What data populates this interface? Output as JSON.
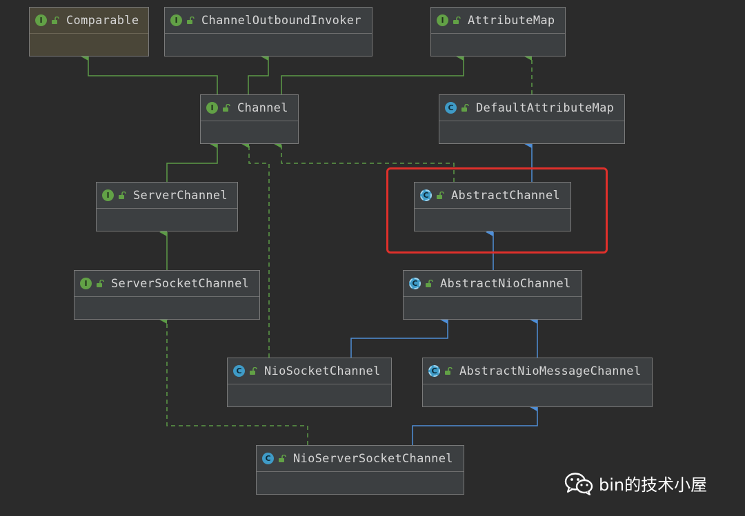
{
  "nodes": {
    "comparable": {
      "name": "Comparable",
      "kind": "interface",
      "badge": "I"
    },
    "channel_outbound_invoker": {
      "name": "ChannelOutboundInvoker",
      "kind": "interface",
      "badge": "I"
    },
    "attribute_map": {
      "name": "AttributeMap",
      "kind": "interface",
      "badge": "I"
    },
    "channel": {
      "name": "Channel",
      "kind": "interface",
      "badge": "I"
    },
    "default_attribute_map": {
      "name": "DefaultAttributeMap",
      "kind": "class",
      "badge": "C"
    },
    "server_channel": {
      "name": "ServerChannel",
      "kind": "interface",
      "badge": "I"
    },
    "abstract_channel": {
      "name": "AbstractChannel",
      "kind": "abstract-class",
      "badge": "C"
    },
    "server_socket_channel": {
      "name": "ServerSocketChannel",
      "kind": "interface",
      "badge": "I"
    },
    "abstract_nio_channel": {
      "name": "AbstractNioChannel",
      "kind": "abstract-class",
      "badge": "C"
    },
    "nio_socket_channel": {
      "name": "NioSocketChannel",
      "kind": "class",
      "badge": "C"
    },
    "abstract_nio_message_channel": {
      "name": "AbstractNioMessageChannel",
      "kind": "abstract-class",
      "badge": "C"
    },
    "nio_server_socket_channel": {
      "name": "NioServerSocketChannel",
      "kind": "class",
      "badge": "C"
    }
  },
  "edges": [
    {
      "from": "channel",
      "to": "comparable",
      "type": "interface-extends"
    },
    {
      "from": "channel",
      "to": "channel_outbound_invoker",
      "type": "interface-extends"
    },
    {
      "from": "channel",
      "to": "attribute_map",
      "type": "interface-extends"
    },
    {
      "from": "default_attribute_map",
      "to": "attribute_map",
      "type": "implements"
    },
    {
      "from": "server_channel",
      "to": "channel",
      "type": "interface-extends"
    },
    {
      "from": "abstract_channel",
      "to": "default_attribute_map",
      "type": "class-extends"
    },
    {
      "from": "abstract_channel",
      "to": "channel",
      "type": "implements"
    },
    {
      "from": "server_socket_channel",
      "to": "server_channel",
      "type": "interface-extends"
    },
    {
      "from": "abstract_nio_channel",
      "to": "abstract_channel",
      "type": "class-extends"
    },
    {
      "from": "nio_socket_channel",
      "to": "abstract_nio_channel",
      "type": "class-extends"
    },
    {
      "from": "nio_socket_channel",
      "to": "channel",
      "type": "implements"
    },
    {
      "from": "abstract_nio_message_channel",
      "to": "abstract_nio_channel",
      "type": "class-extends"
    },
    {
      "from": "nio_server_socket_channel",
      "to": "abstract_nio_message_channel",
      "type": "class-extends"
    },
    {
      "from": "nio_server_socket_channel",
      "to": "server_socket_channel",
      "type": "implements"
    }
  ],
  "highlighted_node": "abstract_channel",
  "colors": {
    "background": "#2b2b2b",
    "interface_edge": "#5d9b47",
    "class_edge": "#4f8fd8",
    "highlight": "#e0302b"
  },
  "watermark": {
    "text": "bin的技术小屋",
    "icon": "wechat-icon"
  }
}
